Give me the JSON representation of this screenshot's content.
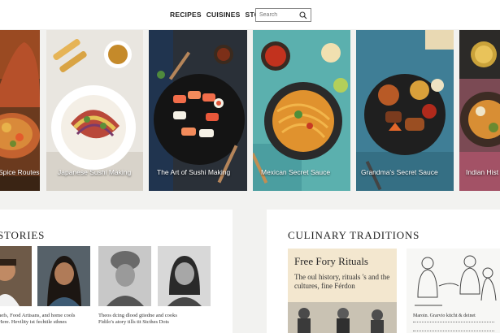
{
  "nav": {
    "items": [
      "RECIPES",
      "CUISINES",
      "STORIES"
    ]
  },
  "search": {
    "placeholder": "Search"
  },
  "cards": [
    {
      "title": "Spice Routes"
    },
    {
      "title": "Japanese Sushi Making"
    },
    {
      "title": "The Art of Sushi Making"
    },
    {
      "title": "Mexican Secret Sauce"
    },
    {
      "title": "Grandma's Secret Sauce"
    },
    {
      "title": "Indian Hist"
    }
  ],
  "stories": {
    "title": "STORIES",
    "caption_left_1": "nefs, Food Artisans, and home cools",
    "caption_left_2": "Here. Hevility ist fechtile sthnes",
    "caption_right_1": "Theos dcing dlood gtiedne and cooks",
    "caption_right_2": "Fidilo's atory tills tit Stcthes Dots"
  },
  "traditions": {
    "title": "CULINARY TRADITIONS",
    "card1_title": "Free Fory Rituals",
    "card1_body": "The oul history, rituals 's and the cultures, fine Férdon",
    "card2_caption": "Maroin. Grarvio kitcht & deinet"
  },
  "colors": {
    "header_bg": "#ffffff",
    "page_bg": "#f2f2f0",
    "card_text": "#ffffff",
    "parchment": "#f3e7cf"
  }
}
